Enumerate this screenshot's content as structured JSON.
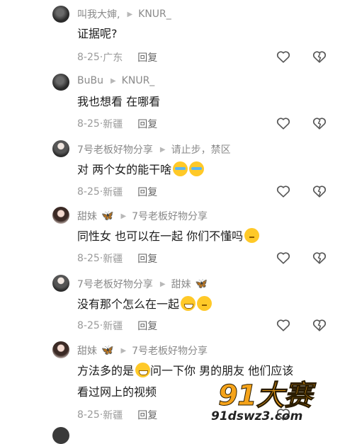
{
  "replies": [
    {
      "author": "叫我大婶,",
      "reply_to": "KNUR_",
      "text": "证据呢?",
      "date": "8-25",
      "location": "广东",
      "reply_label": "回复"
    },
    {
      "author": "BuBu",
      "reply_to": "KNUR_",
      "text": "我也想看 在哪看",
      "date": "8-25",
      "location": "新疆",
      "reply_label": "回复"
    },
    {
      "author": "7号老板好物分享",
      "reply_to": "请止步，禁区",
      "text": "对  两个女的能干啥",
      "emojis": [
        "cry",
        "cry"
      ],
      "date": "8-25",
      "location": "新疆",
      "reply_label": "回复"
    },
    {
      "author": "甜妹",
      "author_badge": "butterfly-icon",
      "reply_to": "7号老板好物分享",
      "text": "同性女 也可以在一起 你们不懂吗",
      "emojis": [
        "think"
      ],
      "date": "8-25",
      "location": "新疆",
      "reply_label": "回复"
    },
    {
      "author": "7号老板好物分享",
      "reply_to": "甜妹",
      "reply_to_badge": "butterfly-icon",
      "text": "没有那个怎么在一起",
      "emojis": [
        "grin",
        "think"
      ],
      "date": "8-25",
      "location": "新疆",
      "reply_label": "回复"
    },
    {
      "author": "甜妹",
      "author_badge": "butterfly-icon",
      "reply_to": "7号老板好物分享",
      "text_part1": "方法多的是",
      "text_part2": "问一下你 男的朋友 他们应该",
      "text_line2": "看过网上的视频",
      "emojis": [
        "grin"
      ],
      "date": "8-25",
      "location": "新疆",
      "reply_label": "回复"
    }
  ],
  "watermark": {
    "logo": "91大赛",
    "url": "91dswz3.com"
  },
  "colors": {
    "name": "#8a8a8a",
    "text": "#1b1b1b",
    "meta": "#9a9a9a",
    "butterfly": "#2f7fe8",
    "watermark_orange": "#f5a31a"
  }
}
